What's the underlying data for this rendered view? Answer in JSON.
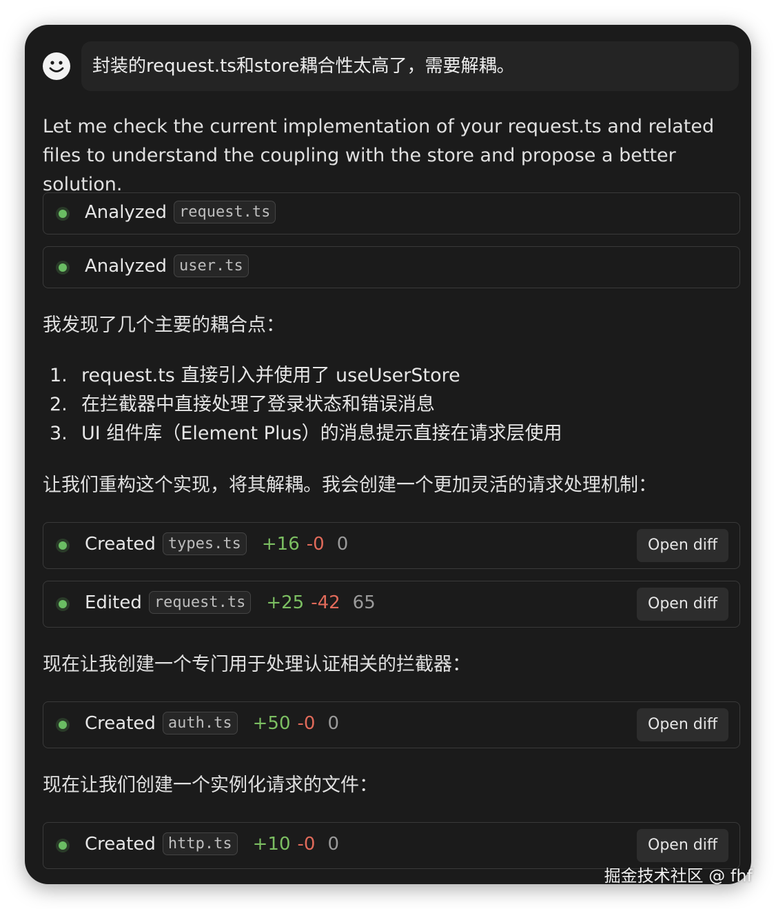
{
  "user_message": {
    "avatar_icon": "smiley-face-icon",
    "text": "封装的request.ts和store耦合性太高了，需要解耦。"
  },
  "intro_text": "Let me check the current implementation of your request.ts and related files to understand the coupling with the store and propose a better solution.",
  "analyzed": [
    {
      "action": "Analyzed",
      "file": "request.ts"
    },
    {
      "action": "Analyzed",
      "file": "user.ts"
    }
  ],
  "found_text": "我发现了几个主要的耦合点：",
  "issues": [
    {
      "num": "1.",
      "text": "request.ts 直接引入并使用了 useUserStore"
    },
    {
      "num": "2.",
      "text": "在拦截器中直接处理了登录状态和错误消息"
    },
    {
      "num": "3.",
      "text": "UI 组件库（Element Plus）的消息提示直接在请求层使用"
    }
  ],
  "refactor_text": "让我们重构这个实现，将其解耦。我会创建一个更加灵活的请求处理机制：",
  "changes_a": [
    {
      "action": "Created",
      "file": "types.ts",
      "added": "+16",
      "removed": "-0",
      "count": "0",
      "button": "Open diff"
    },
    {
      "action": "Edited",
      "file": "request.ts",
      "added": "+25",
      "removed": "-42",
      "count": "65",
      "button": "Open diff"
    }
  ],
  "auth_text": "现在让我创建一个专门用于处理认证相关的拦截器：",
  "change_auth": {
    "action": "Created",
    "file": "auth.ts",
    "added": "+50",
    "removed": "-0",
    "count": "0",
    "button": "Open diff"
  },
  "http_text": "现在让我们创建一个实例化请求的文件：",
  "change_http": {
    "action": "Created",
    "file": "http.ts",
    "added": "+10",
    "removed": "-0",
    "count": "0",
    "button": "Open diff"
  },
  "watermark": "掘金技术社区 @ fhf",
  "colors": {
    "added": "#7cbf62",
    "removed": "#e06a5a",
    "status_dot": "#6abd63",
    "background": "#1b1b1b"
  }
}
